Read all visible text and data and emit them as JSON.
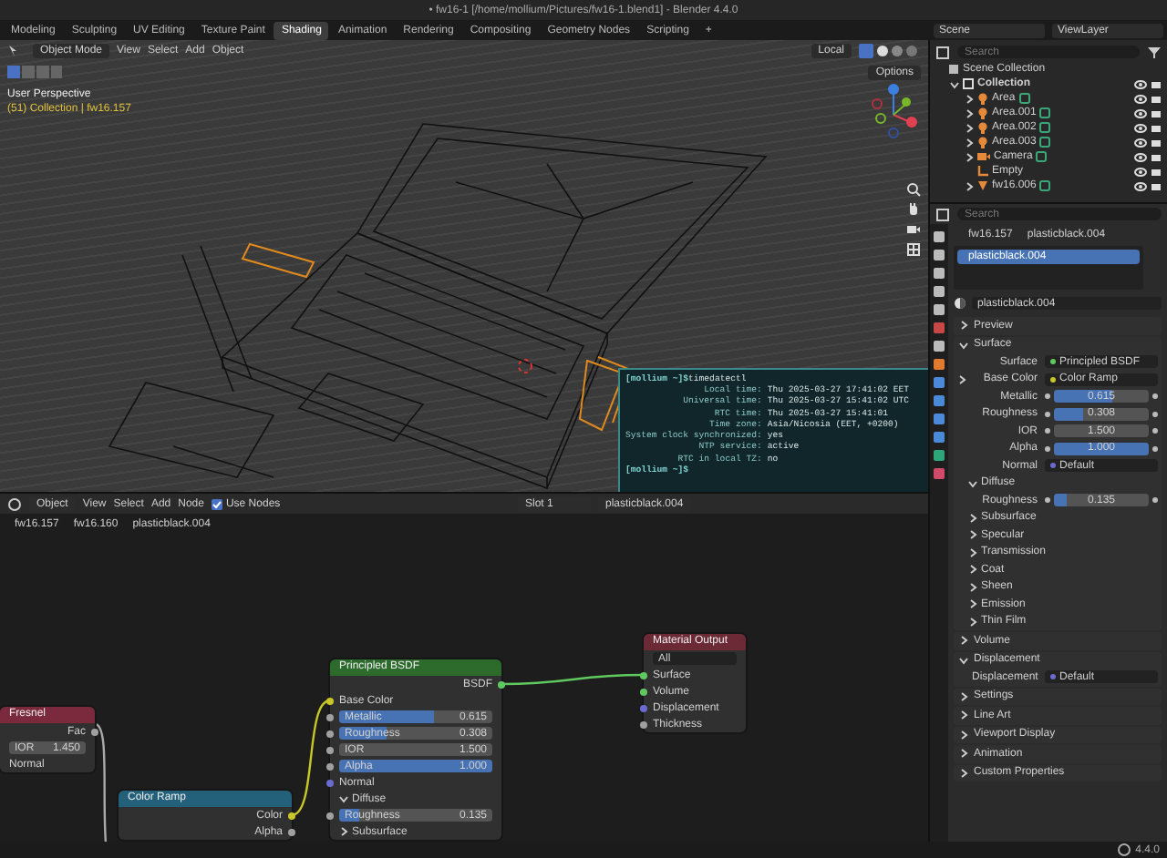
{
  "window": {
    "title": "• fw16-1 [/home/mollium/Pictures/fw16-1.blend1] - Blender 4.4.0"
  },
  "workspace_tabs": [
    {
      "label": "Modeling",
      "selected": false
    },
    {
      "label": "Sculpting",
      "selected": false
    },
    {
      "label": "UV Editing",
      "selected": false
    },
    {
      "label": "Texture Paint",
      "selected": false
    },
    {
      "label": "Shading",
      "selected": true
    },
    {
      "label": "Animation",
      "selected": false
    },
    {
      "label": "Rendering",
      "selected": false
    },
    {
      "label": "Compositing",
      "selected": false
    },
    {
      "label": "Geometry Nodes",
      "selected": false
    },
    {
      "label": "Scripting",
      "selected": false
    }
  ],
  "add_tab": "+",
  "scene": {
    "scene": "Scene",
    "view_layer": "ViewLayer"
  },
  "viewport": {
    "mode": "Object Mode",
    "menus": [
      "View",
      "Select",
      "Add",
      "Object"
    ],
    "orientation": "Local",
    "options": "Options",
    "info": [
      "User Perspective",
      "(51) Collection | fw16.157"
    ]
  },
  "terminal": {
    "lines": [
      {
        "kind": "prompt",
        "prompt": "[mollium ~]$",
        "command": "timedatectl"
      },
      {
        "kind": "pair",
        "label": "Local time:",
        "value": "Thu 2025-03-27 17:41:02 EET"
      },
      {
        "kind": "pair",
        "label": "Universal time:",
        "value": "Thu 2025-03-27 15:41:02 UTC"
      },
      {
        "kind": "pair",
        "label": "RTC time:",
        "value": "Thu 2025-03-27 15:41:01"
      },
      {
        "kind": "pair",
        "label": "Time zone:",
        "value": "Asia/Nicosia (EET, +0200)"
      },
      {
        "kind": "pair",
        "label": "System clock synchronized:",
        "value": "yes"
      },
      {
        "kind": "pair",
        "label": "NTP service:",
        "value": "active"
      },
      {
        "kind": "pair",
        "label": "RTC in local TZ:",
        "value": "no"
      },
      {
        "kind": "prompt",
        "prompt": "[mollium ~]$"
      }
    ]
  },
  "outliner": {
    "search": {
      "placeholder": "Search"
    },
    "tree": [
      {
        "label": "Scene Collection",
        "kind": "scene",
        "children": [
          {
            "label": "Collection",
            "kind": "collection",
            "expanded": true,
            "children": [
              {
                "label": "Area",
                "kind": "light",
                "expanded": false
              },
              {
                "label": "Area.001",
                "kind": "light",
                "expanded": false
              },
              {
                "label": "Area.002",
                "kind": "light",
                "expanded": false
              },
              {
                "label": "Area.003",
                "kind": "light",
                "expanded": false
              },
              {
                "label": "Camera",
                "kind": "camera",
                "expanded": false
              },
              {
                "label": "Empty",
                "kind": "empty"
              },
              {
                "label": "fw16.006",
                "kind": "mesh",
                "expanded": false
              }
            ]
          }
        ]
      }
    ]
  },
  "properties": {
    "search": {
      "placeholder": "Search"
    },
    "breadcrumb": [
      "fw16.157",
      "plasticblack.004"
    ],
    "slots": [
      {
        "label": "plasticblack.004",
        "selected": true
      }
    ],
    "material": "plasticblack.004",
    "panels": [
      {
        "label": "Preview",
        "expanded": false
      },
      {
        "label": "Surface",
        "expanded": true,
        "rows": [
          {
            "kind": "link",
            "label": "Surface",
            "value": "Principled BSDF",
            "color": "#5fc95f"
          },
          {
            "kind": "link",
            "label": "Base Color",
            "value": "Color Ramp",
            "color": "#c7c729",
            "expanded": false
          },
          {
            "kind": "slider",
            "label": "Metallic",
            "value": "0.615",
            "level": 0.615
          },
          {
            "kind": "slider",
            "label": "Roughness",
            "value": "0.308",
            "level": 0.308
          },
          {
            "kind": "number",
            "label": "IOR",
            "value": "1.500"
          },
          {
            "kind": "slider",
            "label": "Alpha",
            "value": "1.000",
            "level": 1
          },
          {
            "kind": "link",
            "label": "Normal",
            "value": "Default",
            "color": "#6a6ad0"
          },
          {
            "kind": "section",
            "label": "Diffuse",
            "expanded": true
          },
          {
            "kind": "slider",
            "label": "Roughness",
            "value": "0.135",
            "level": 0.135
          },
          {
            "kind": "section",
            "label": "Subsurface",
            "expanded": false
          },
          {
            "kind": "section",
            "label": "Specular",
            "expanded": false
          },
          {
            "kind": "section",
            "label": "Transmission",
            "expanded": false
          },
          {
            "kind": "section",
            "label": "Coat",
            "expanded": false
          },
          {
            "kind": "section",
            "label": "Sheen",
            "expanded": false
          },
          {
            "kind": "section",
            "label": "Emission",
            "expanded": false
          },
          {
            "kind": "section",
            "label": "Thin Film",
            "expanded": false
          }
        ]
      },
      {
        "label": "Volume",
        "expanded": false
      },
      {
        "label": "Displacement",
        "expanded": true,
        "rows": [
          {
            "kind": "link",
            "label": "Displacement",
            "value": "Default",
            "color": "#6a6ad0"
          }
        ]
      },
      {
        "label": "Settings",
        "expanded": false
      },
      {
        "label": "Line Art",
        "expanded": false
      },
      {
        "label": "Viewport Display",
        "expanded": false
      },
      {
        "label": "Animation",
        "expanded": false
      },
      {
        "label": "Custom Properties",
        "expanded": false
      }
    ]
  },
  "node_editor": {
    "object_mode": "Object",
    "menus": [
      "View",
      "Select",
      "Add",
      "Node"
    ],
    "use_nodes": {
      "label": "Use Nodes",
      "checked": true
    },
    "slot": "Slot 1",
    "material": "plasticblack.004",
    "breadcrumb": [
      "fw16.157",
      "fw16.160",
      "plasticblack.004"
    ],
    "nodes": [
      {
        "title": "Fresnel",
        "color": "#7a2a3c",
        "rows": [
          {
            "kind": "output",
            "label": "Fac",
            "color": "#a1a1a1"
          },
          {
            "kind": "number",
            "label": "IOR",
            "value": "1.450"
          },
          {
            "kind": "input",
            "label": "Normal"
          }
        ]
      },
      {
        "title": "Color Ramp",
        "color": "#23607a",
        "rows": [
          {
            "kind": "output",
            "label": "Color",
            "color": "#c7c729"
          },
          {
            "kind": "output",
            "label": "Alpha",
            "color": "#a1a1a1"
          }
        ]
      },
      {
        "title": "Principled BSDF",
        "color": "#2c6b2c",
        "rows": [
          {
            "kind": "output",
            "label": "BSDF",
            "color": "#5fc95f"
          },
          {
            "kind": "input",
            "label": "Base Color",
            "color": "#c7c729"
          },
          {
            "kind": "slider",
            "label": "Metallic",
            "value": "0.615",
            "level": 0.615,
            "color": "#a1a1a1"
          },
          {
            "kind": "slider",
            "label": "Roughness",
            "value": "0.308",
            "level": 0.308,
            "color": "#a1a1a1"
          },
          {
            "kind": "number",
            "label": "IOR",
            "value": "1.500",
            "color": "#a1a1a1"
          },
          {
            "kind": "slider",
            "label": "Alpha",
            "value": "1.000",
            "level": 1,
            "color": "#a1a1a1"
          },
          {
            "kind": "input",
            "label": "Normal",
            "color": "#6a6ad0"
          },
          {
            "kind": "section",
            "label": "Diffuse",
            "expanded": true
          },
          {
            "kind": "slider",
            "label": "Roughness",
            "value": "0.135",
            "level": 0.135,
            "color": "#a1a1a1"
          },
          {
            "kind": "section",
            "label": "Subsurface",
            "expanded": false
          }
        ]
      },
      {
        "title": "Material Output",
        "color": "#6b2a35",
        "rows": [
          {
            "kind": "dropdown",
            "value": "All"
          },
          {
            "kind": "input",
            "label": "Surface",
            "color": "#5fc95f"
          },
          {
            "kind": "input",
            "label": "Volume",
            "color": "#5fc95f"
          },
          {
            "kind": "input",
            "label": "Displacement",
            "color": "#6a6ad0"
          },
          {
            "kind": "input",
            "label": "Thickness",
            "color": "#a1a1a1"
          }
        ]
      }
    ]
  },
  "status_bar": {
    "version": "4.4.0"
  }
}
